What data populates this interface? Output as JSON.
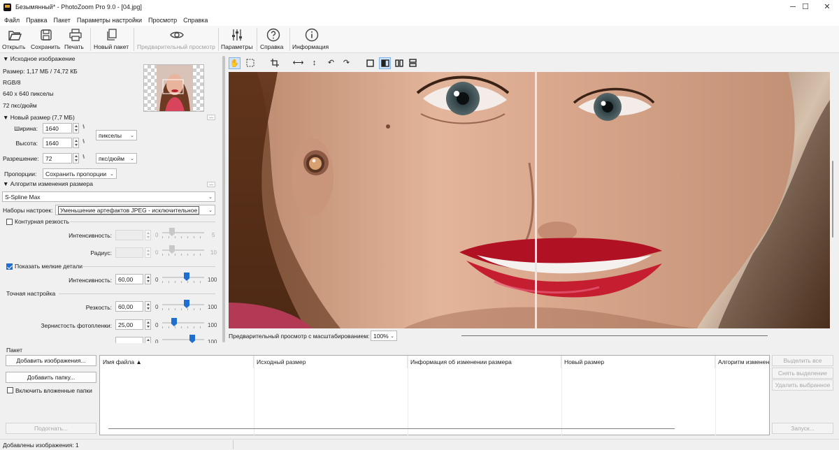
{
  "window": {
    "title": "Безымянный* - PhotoZoom Pro 9.0 - [04.jpg]",
    "controls": [
      "─",
      "☐",
      "✕"
    ]
  },
  "menu": [
    "Файл",
    "Правка",
    "Пакет",
    "Параметры настройки",
    "Просмотр",
    "Справка"
  ],
  "toolbar": {
    "open": "Открыть",
    "save": "Сохранить",
    "print": "Печать",
    "new_batch": "Новый пакет",
    "preview": "Предварительный просмотр",
    "settings": "Параметры",
    "help": "Справка",
    "info": "Информация"
  },
  "source": {
    "header": "▼ Исходное изображение",
    "size": "Размер: 1,17 МБ / 74,72 КБ",
    "mode": "RGB/8",
    "dims": "640 x 640 пикселы",
    "dpi": "72 пкс/дюйм"
  },
  "new_size": {
    "header": "▼ Новый размер (7,7 МБ)",
    "width_label": "Ширина:",
    "width": "1640",
    "height_label": "Высота:",
    "height": "1640",
    "res_label": "Разрешение:",
    "res": "72",
    "unit": "пикселы",
    "res_unit": "пкс/дюйм",
    "proportions_label": "Пропорции:",
    "proportions": "Сохранить пропорции"
  },
  "algorithm": {
    "header": "▼ Алгоритм изменения размера",
    "method": "S-Spline Max",
    "preset_label": "Наборы настроек:",
    "preset": "Уменьшение артефактов JPEG - исключительное"
  },
  "sharpness": {
    "label": "Контурная резкость",
    "intensity_label": "Интенсивность:",
    "intensity_min": "0",
    "intensity_max": "5",
    "radius_label": "Радиус:",
    "radius_min": "0",
    "radius_max": "10"
  },
  "details": {
    "label": "Показать мелкие детали",
    "intensity_label": "Интенсивность:",
    "intensity": "60,00",
    "min": "0",
    "max": "100",
    "level": 0.6
  },
  "fine": {
    "header": "Точная настройка",
    "sharp_label": "Резкость:",
    "sharp": "60,00",
    "sharp_min": "0",
    "sharp_max": "100",
    "sharp_level": 0.6,
    "grain_label": "Зернистость фотопленки:",
    "grain": "25,00",
    "grain_min": "0",
    "grain_max": "100",
    "grain_level": 0.25,
    "extra_min": "0",
    "extra_max": "100",
    "extra_level": 0.75
  },
  "preview_zoom": {
    "label": "Предварительный просмотр с масштабированием:",
    "value": "100%"
  },
  "batch": {
    "header": "Пакет",
    "add_images": "Добавить изображения...",
    "add_folder": "Добавить папку...",
    "include_sub": "Включить вложенные папки",
    "fit": "Подогнать...",
    "columns": [
      "Имя файла ▲",
      "Исходный размер",
      "Информация об изменении размера",
      "Новый размер",
      "Алгоритм изменен"
    ],
    "select_all": "Выделить все",
    "deselect": "Снять выделение",
    "remove_selected": "Удалить выбранное",
    "run": "Запуск..."
  },
  "status": "Добавлены изображения: 1",
  "colors": {
    "accent": "#1f6fd0",
    "lips": "#c01a2a"
  }
}
